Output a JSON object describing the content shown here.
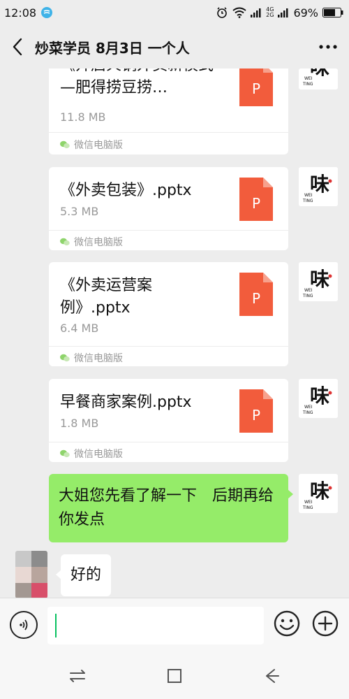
{
  "status_bar": {
    "time": "12:08",
    "network_top": "4G",
    "network_bottom": "2G",
    "battery": "69%"
  },
  "header": {
    "title": "炒菜学员 8月3日 一个人",
    "back_icon": "chevron-left-icon",
    "more_icon": "more-dots-icon"
  },
  "messages": {
    "file1": {
      "title": "《开启火锅外卖新模式—肥得捞豆捞…",
      "size": "11.8 MB",
      "source": "微信电脑版",
      "icon_letter": "P"
    },
    "file2": {
      "title": "《外卖包装》.pptx",
      "size": "5.3 MB",
      "source": "微信电脑版",
      "icon_letter": "P"
    },
    "file3": {
      "title": "《外卖运营案例》.pptx",
      "size": "6.4 MB",
      "source": "微信电脑版",
      "icon_letter": "P"
    },
    "file4": {
      "title": "早餐商家案例.pptx",
      "size": "1.8 MB",
      "source": "微信电脑版",
      "icon_letter": "P"
    },
    "text_sent": "大姐您先看了解一下　后期再给你发点",
    "text_received": "好的"
  },
  "avatar_logo": {
    "char": "味",
    "latin_top": "WEI",
    "latin_bottom": "TING"
  },
  "input": {
    "placeholder": ""
  },
  "colors": {
    "background": "#ededed",
    "bubble_sent": "#95ec69",
    "ppt_icon": "#f25c3c",
    "caret": "#07c160"
  }
}
